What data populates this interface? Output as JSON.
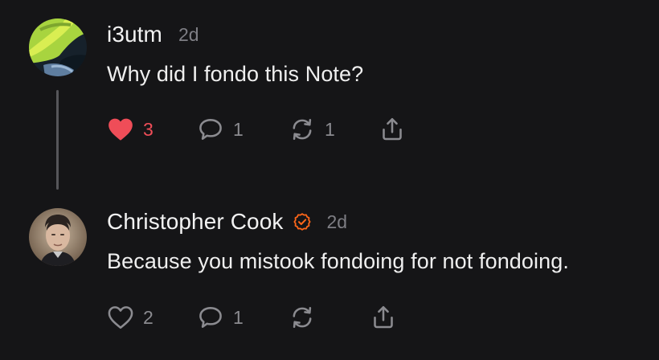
{
  "notes": [
    {
      "username": "i3utm",
      "time": "2d",
      "text": "Why did I fondo this Note?",
      "verified": false,
      "liked": true,
      "actions": {
        "like_count": "3",
        "reply_count": "1",
        "restack_count": "1"
      }
    },
    {
      "username": "Christopher Cook",
      "time": "2d",
      "text": "Because you mistook fondoing for not fondoing.",
      "verified": true,
      "liked": false,
      "actions": {
        "like_count": "2",
        "reply_count": "1"
      }
    }
  ],
  "icons": {
    "like": "heart-icon",
    "reply": "speech-bubble-icon",
    "restack": "restack-arrows-icon",
    "share": "share-icon",
    "verified": "verified-badge-icon"
  },
  "colors": {
    "background": "#151517",
    "liked": "#ef4d58",
    "muted": "#8b8b90",
    "verified": "#ff6719"
  }
}
